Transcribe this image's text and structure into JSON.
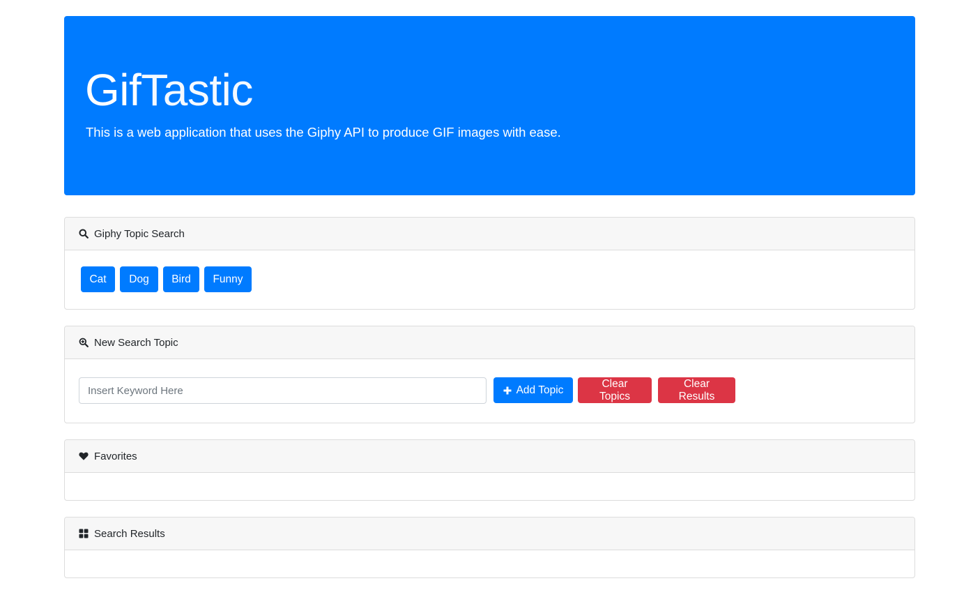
{
  "jumbotron": {
    "title_bold": "Gif",
    "title_light": "Tastic",
    "lead": "This is a web application that uses the Giphy API to produce GIF images with ease."
  },
  "topic_search": {
    "header": "Giphy Topic Search",
    "icon": "search-icon",
    "topics": [
      "Cat",
      "Dog",
      "Bird",
      "Funny"
    ]
  },
  "new_topic": {
    "header": "New Search Topic",
    "icon": "search-plus-icon",
    "input_placeholder": "Insert Keyword Here",
    "input_value": "",
    "add_label": "Add Topic",
    "clear_topics_label": "Clear Topics",
    "clear_results_label": "Clear Results"
  },
  "favorites": {
    "header": "Favorites",
    "icon": "heart-icon"
  },
  "results": {
    "header": "Search Results",
    "icon": "grid-icon"
  },
  "colors": {
    "primary": "#007bff",
    "danger": "#dc3545",
    "header_bg": "#f7f7f7"
  }
}
